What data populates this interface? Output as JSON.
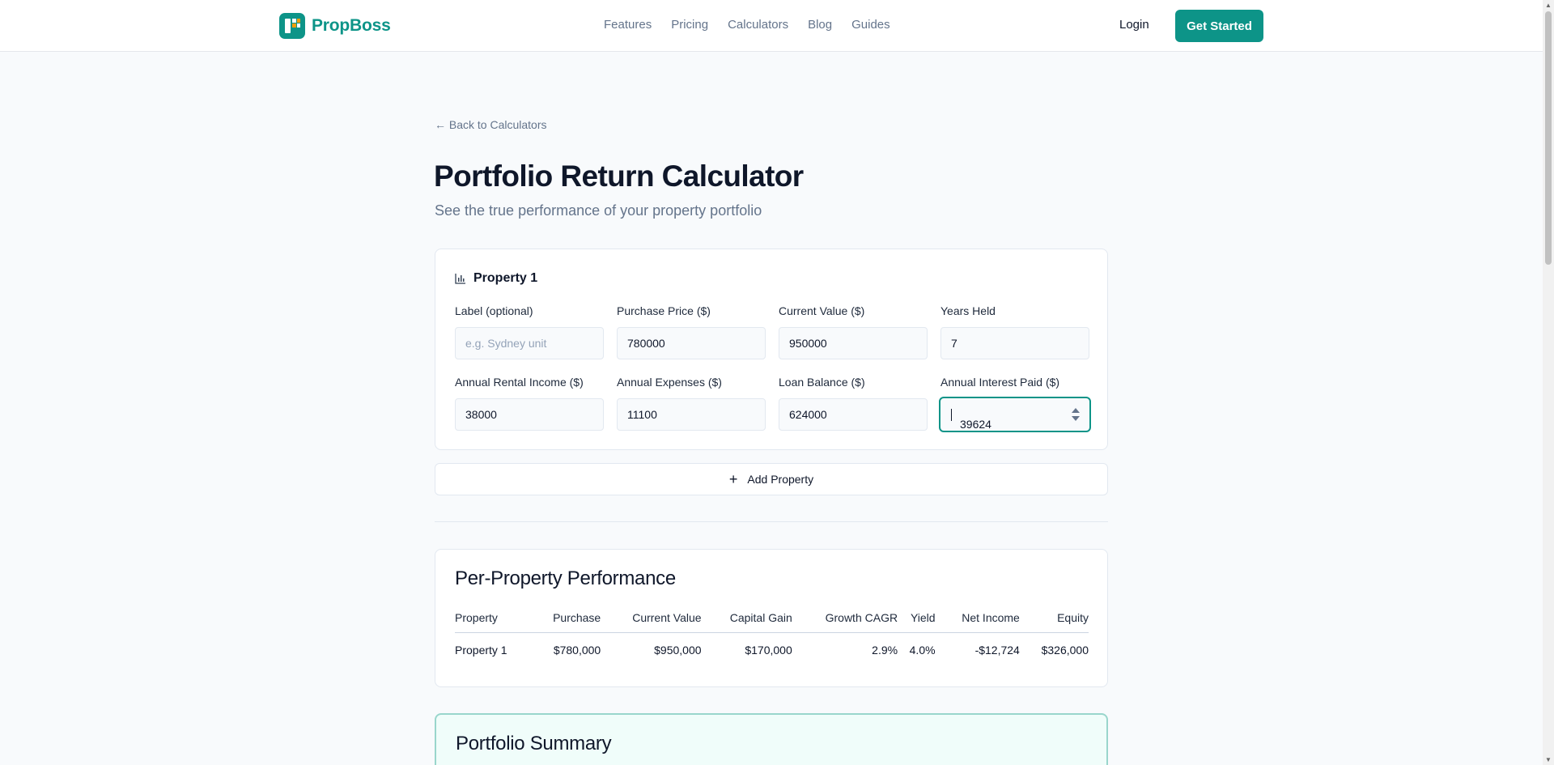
{
  "header": {
    "brand": "PropBoss",
    "nav": [
      "Features",
      "Pricing",
      "Calculators",
      "Blog",
      "Guides"
    ],
    "login": "Login",
    "cta": "Get Started"
  },
  "page": {
    "back_link": "← Back to Calculators",
    "title": "Portfolio Return Calculator",
    "subtitle": "See the true performance of your property portfolio"
  },
  "property": {
    "heading": "Property 1",
    "fields": {
      "label": {
        "label": "Label (optional)",
        "value": "",
        "placeholder": "e.g. Sydney unit"
      },
      "purchase_price": {
        "label": "Purchase Price ($)",
        "value": "780000"
      },
      "current_value": {
        "label": "Current Value ($)",
        "value": "950000"
      },
      "years_held": {
        "label": "Years Held",
        "value": "7"
      },
      "rental_income": {
        "label": "Annual Rental Income ($)",
        "value": "38000"
      },
      "expenses": {
        "label": "Annual Expenses ($)",
        "value": "11100"
      },
      "loan_balance": {
        "label": "Loan Balance ($)",
        "value": "624000"
      },
      "interest_paid": {
        "label": "Annual Interest Paid ($)",
        "value": "39624"
      }
    }
  },
  "add_property": "Add Property",
  "performance": {
    "title": "Per-Property Performance",
    "columns": [
      "Property",
      "Purchase",
      "Current Value",
      "Capital Gain",
      "Growth CAGR",
      "Yield",
      "Net Income",
      "Equity"
    ],
    "rows": [
      [
        "Property 1",
        "$780,000",
        "$950,000",
        "$170,000",
        "2.9%",
        "4.0%",
        "-$12,724",
        "$326,000"
      ]
    ]
  },
  "summary": {
    "title": "Portfolio Summary"
  },
  "colors": {
    "accent": "#0d9488",
    "positive": "#16a34a",
    "negative": "#dc2626"
  }
}
